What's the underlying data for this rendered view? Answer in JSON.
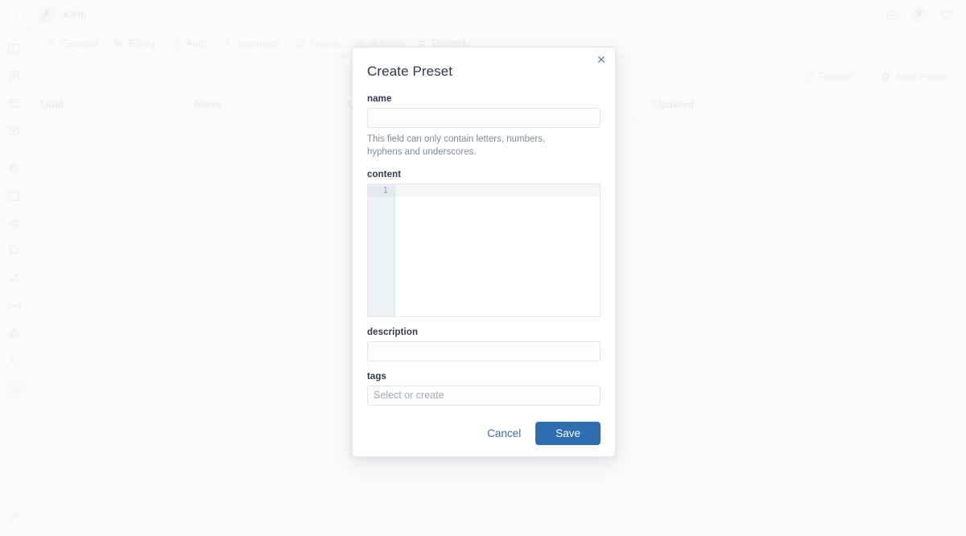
{
  "topbar": {
    "menu_icon": "grid-dots-icon",
    "org_initial": "A",
    "org_name": "acme",
    "actions": [
      {
        "name": "new-folder-button",
        "icon": "folder-plus-icon"
      },
      {
        "name": "user-avatar",
        "icon": "avatar-icon",
        "initial": "R"
      },
      {
        "name": "help-button",
        "icon": "question-circle-icon"
      }
    ]
  },
  "rail": {
    "items": [
      {
        "name": "sidebar-panels",
        "icon": "panel-layout-icon",
        "selected": false
      },
      {
        "name": "sidebar-dashboard",
        "icon": "grid-squares-icon",
        "selected": false
      },
      {
        "name": "sidebar-console",
        "icon": "terminal-window-icon",
        "selected": false
      },
      {
        "name": "sidebar-package",
        "icon": "cube-icon",
        "selected": false
      },
      {
        "name": "sidebar-explore",
        "icon": "search-circle-icon",
        "selected": false
      },
      {
        "name": "sidebar-analytics",
        "icon": "bar-chart-icon",
        "selected": false
      },
      {
        "name": "sidebar-topology",
        "icon": "nodes-graph-icon",
        "selected": false
      },
      {
        "name": "sidebar-bus",
        "icon": "bus-icon",
        "selected": false
      },
      {
        "name": "sidebar-filters",
        "icon": "sliders-icon",
        "selected": false
      },
      {
        "name": "sidebar-broadcast",
        "icon": "broadcast-icon",
        "selected": false
      },
      {
        "name": "sidebar-reports",
        "icon": "chart-columns-icon",
        "selected": false
      },
      {
        "name": "sidebar-shell",
        "icon": "prompt-icon",
        "selected": false
      },
      {
        "name": "sidebar-settings",
        "icon": "gear-icon",
        "selected": true
      }
    ],
    "collapse": {
      "name": "collapse-sidebar-button",
      "icon": "collapse-arrow-icon"
    }
  },
  "tabs": [
    {
      "label": "General",
      "icon": "wrench-icon",
      "active": false
    },
    {
      "label": "Billing",
      "icon": "card-icon",
      "active": false
    },
    {
      "label": "Auth",
      "icon": "key-door-icon",
      "active": false
    },
    {
      "label": "members",
      "icon": "person-icon",
      "active": false
    },
    {
      "label": "Teams",
      "icon": "teams-icon",
      "active": false
    },
    {
      "label": "Agents",
      "icon": "agent-circle-icon",
      "active": false
    },
    {
      "label": "Presets",
      "icon": "preset-icon",
      "active": true
    }
  ],
  "action_row": {
    "refresh_label": "Refresh",
    "refresh_icon": "refresh-icon",
    "new_preset_label": "New Preset",
    "new_preset_icon": "plus-circle-icon"
  },
  "table": {
    "columns": [
      "Uuid",
      "Name",
      "Created",
      "Updated"
    ],
    "rows": []
  },
  "modal": {
    "title": "Create Preset",
    "close_icon": "close-icon",
    "name": {
      "label": "name",
      "value": "",
      "placeholder": "",
      "help": "This field can only contain letters, numbers, hyphens and underscores."
    },
    "content": {
      "label": "content",
      "value": "",
      "line_numbers": [
        "1"
      ]
    },
    "description": {
      "label": "description",
      "value": "",
      "placeholder": ""
    },
    "tags": {
      "label": "tags",
      "placeholder": "Select or create"
    },
    "cancel_label": "Cancel",
    "save_label": "Save"
  },
  "colors": {
    "primary": "#2f6cb0",
    "link": "#3d70ae",
    "border": "#e2e5ea",
    "muted_text": "#828b99"
  }
}
